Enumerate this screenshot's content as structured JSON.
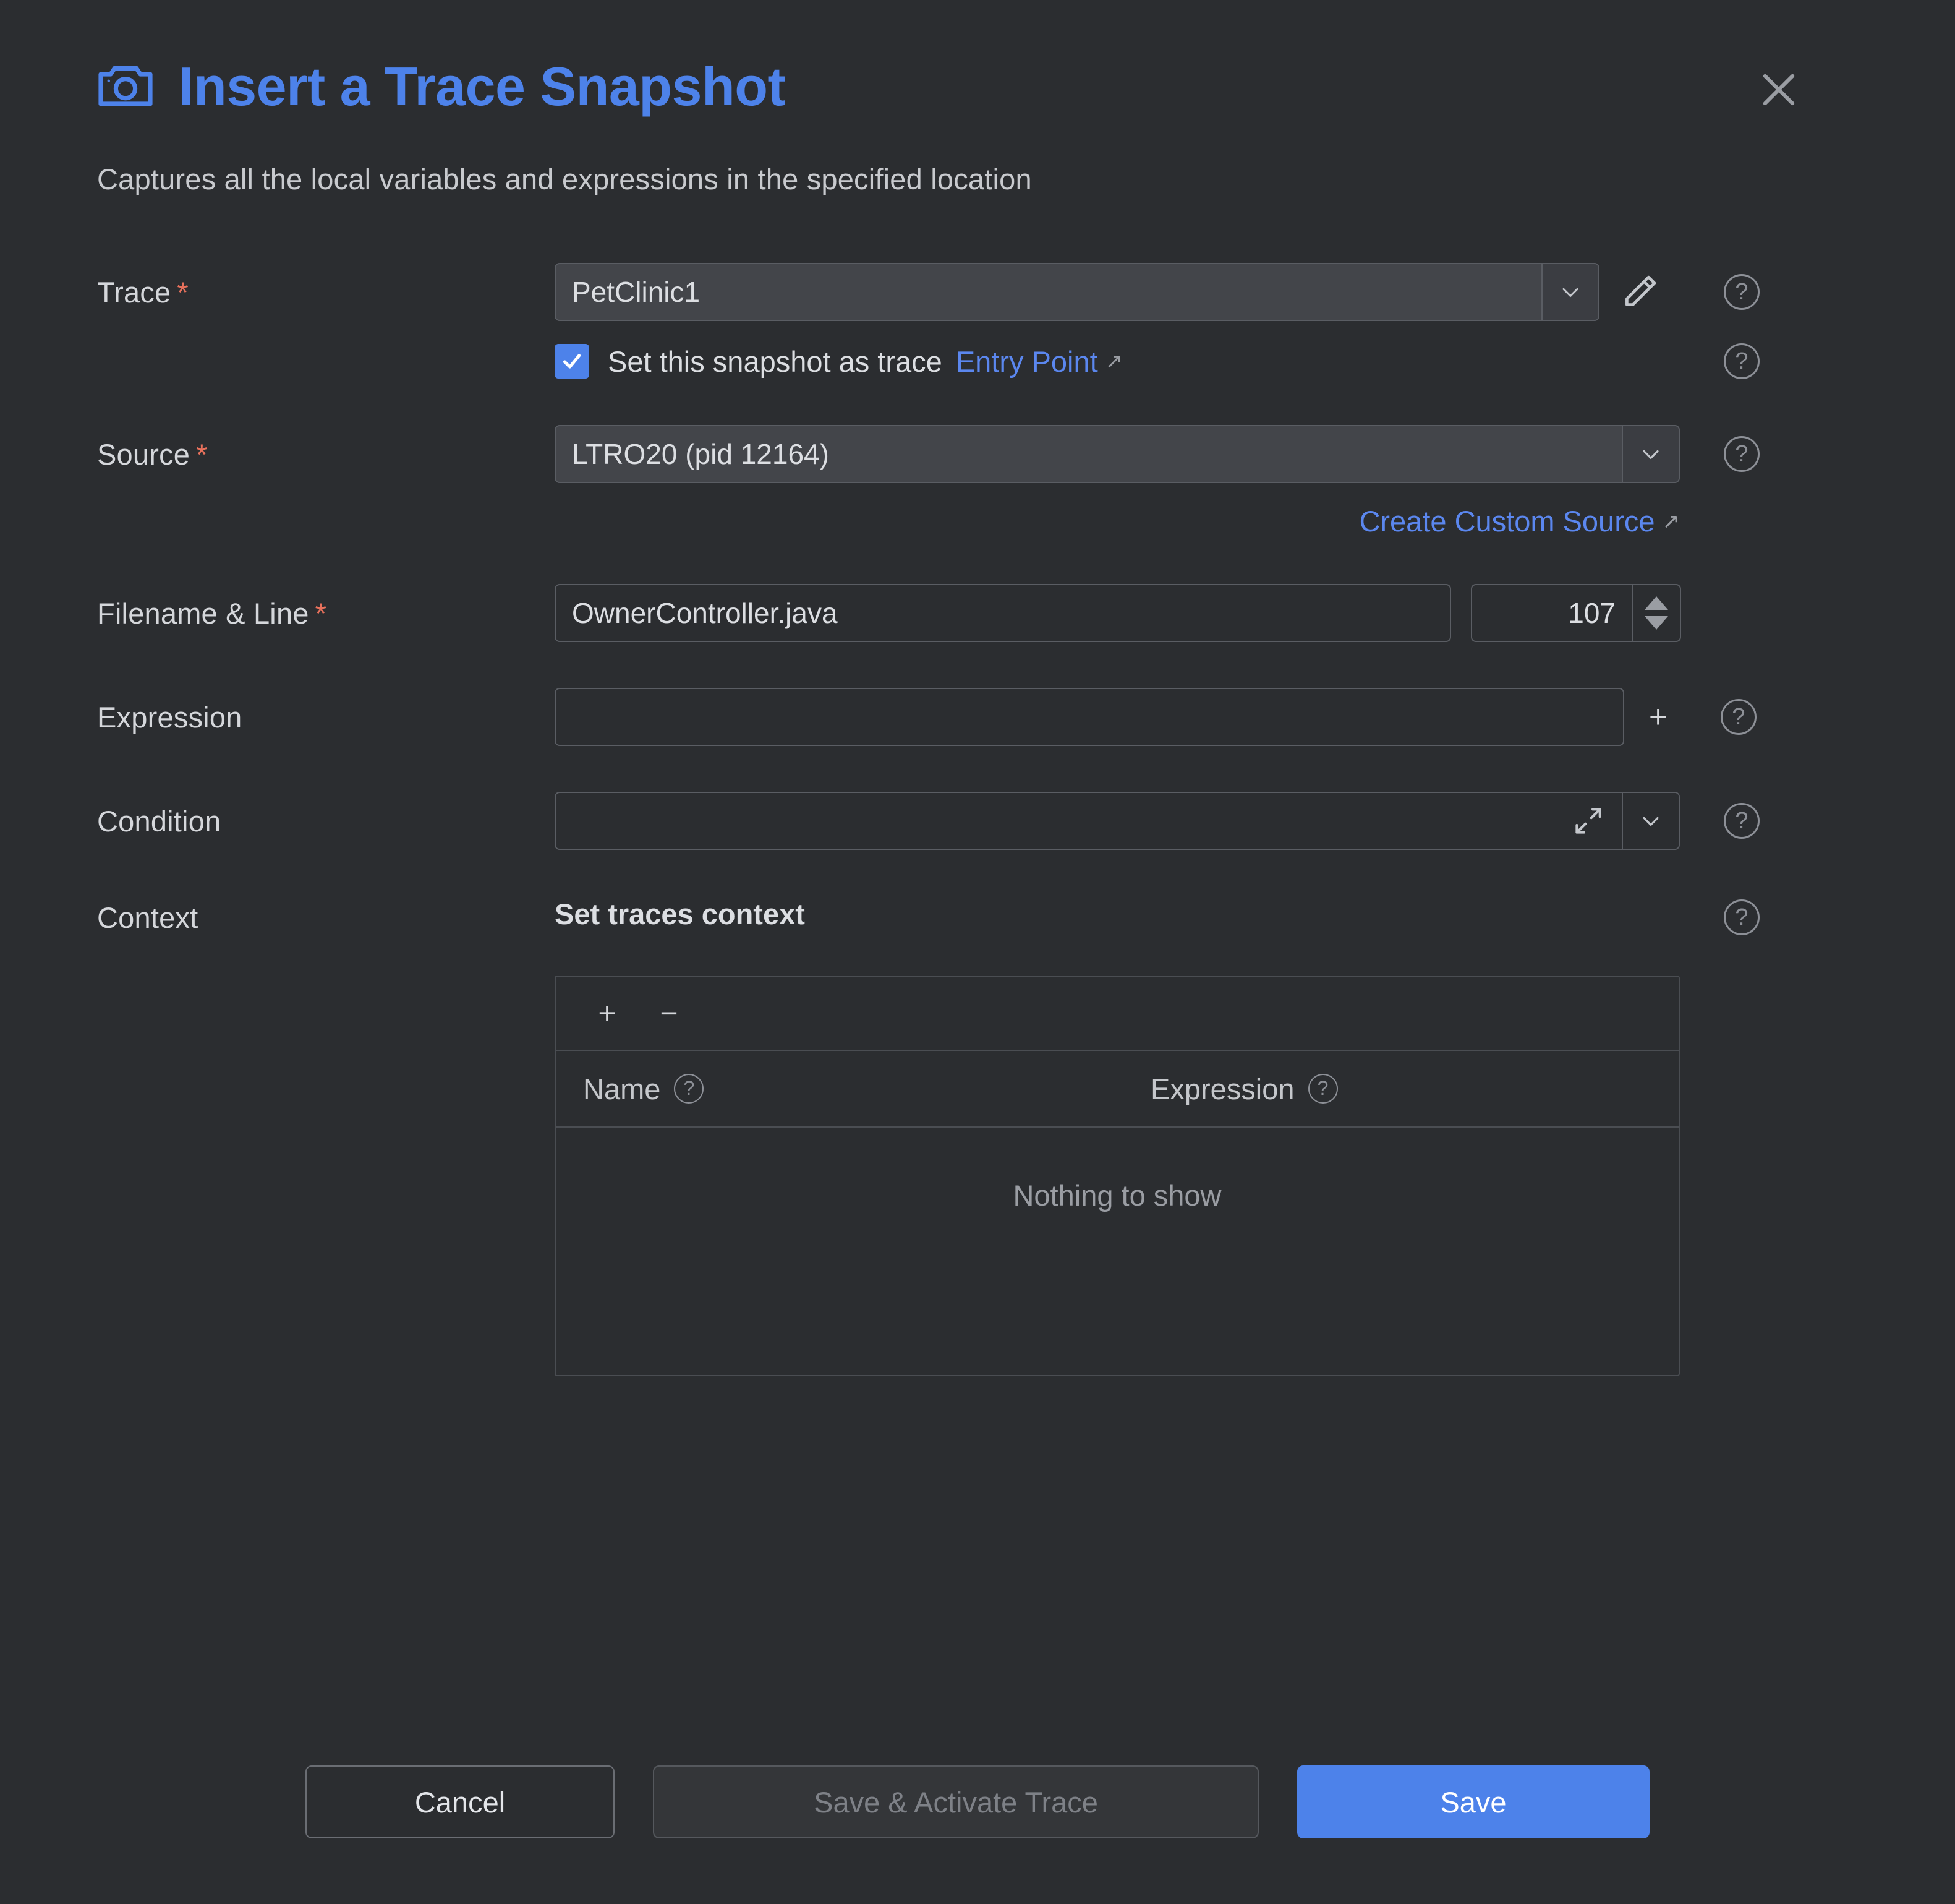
{
  "dialog": {
    "icon": "camera-icon",
    "title": "Insert a Trace Snapshot",
    "subtitle": "Captures all the local variables and expressions in the specified location",
    "close_label": "✕",
    "accent_color": "#4d82ea",
    "link_color": "#5b87ef",
    "required_color": "#e8715c",
    "background_color": "#2b2d30"
  },
  "fields": {
    "trace": {
      "label": "Trace",
      "required_marker": "*",
      "value": "PetClinic1",
      "dropdown_icon": "chevron-down-icon",
      "edit_icon": "pencil-icon",
      "help_icon": "question-mark-icon"
    },
    "entry_point": {
      "checked": true,
      "check_glyph": "✓",
      "label": "Set this snapshot as trace",
      "link_label": "Entry Point",
      "external_icon": "↗",
      "help_icon": "question-mark-icon"
    },
    "source": {
      "label": "Source",
      "required_marker": "*",
      "value": "LTRO20 (pid 12164)",
      "dropdown_icon": "chevron-down-icon",
      "help_icon": "question-mark-icon",
      "create_link": "Create Custom Source",
      "create_link_icon": "↗"
    },
    "filename_line": {
      "label": "Filename & Line",
      "required_marker": "*",
      "filename_value": "OwnerController.java",
      "filename_placeholder": "",
      "line_value": "107",
      "spinner_up_icon": "triangle-up-icon",
      "spinner_down_icon": "triangle-down-icon"
    },
    "expression": {
      "label": "Expression",
      "value": "",
      "placeholder": "",
      "add_label": "+",
      "help_icon": "question-mark-icon"
    },
    "condition": {
      "label": "Condition",
      "value": "",
      "placeholder": "",
      "expand_icon": "expand-diagonal-icon",
      "dropdown_icon": "chevron-down-icon",
      "help_icon": "question-mark-icon"
    },
    "context": {
      "label": "Context",
      "section_title": "Set traces context",
      "help_icon": "question-mark-icon",
      "toolbar": {
        "add_label": "+",
        "remove_label": "−"
      },
      "columns": [
        {
          "label": "Name",
          "help_icon": "question-mark-icon"
        },
        {
          "label": "Expression",
          "help_icon": "question-mark-icon"
        }
      ],
      "rows": [],
      "empty_text": "Nothing to show"
    }
  },
  "footer": {
    "cancel_label": "Cancel",
    "save_activate_label": "Save & Activate Trace",
    "save_activate_disabled": true,
    "save_label": "Save"
  }
}
